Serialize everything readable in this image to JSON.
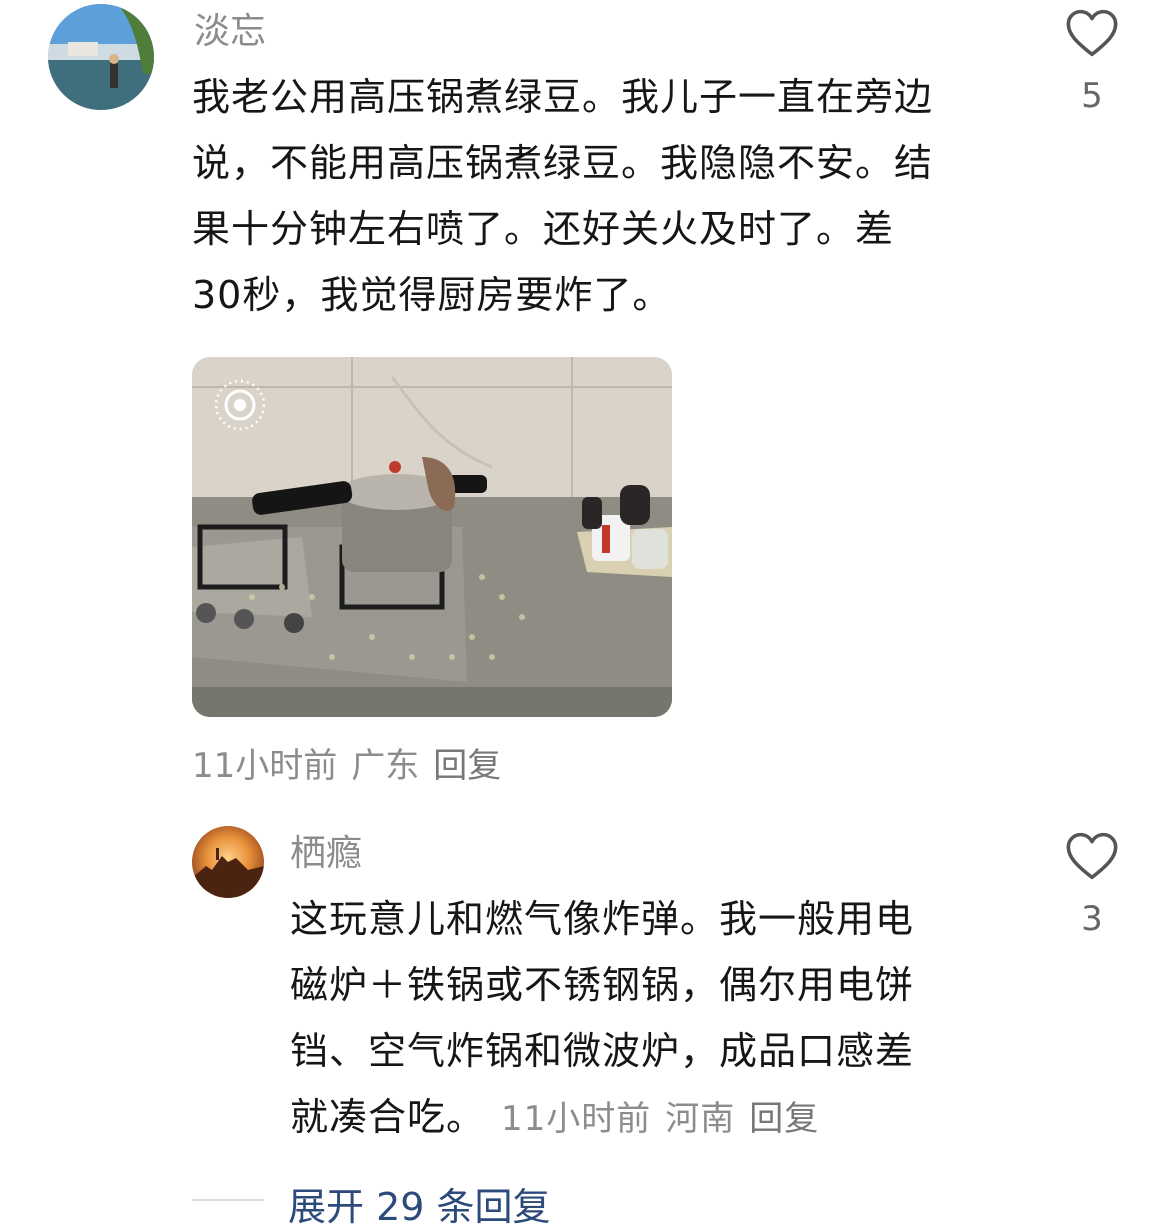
{
  "comment1": {
    "username": "淡忘",
    "lines": [
      "我老公用高压锅煮绿豆。我儿子一直在旁边",
      "说，不能用高压锅煮绿豆。我隐隐不安。结",
      "果十分钟左右喷了。还好关火及时了。差",
      " 30秒，我觉得厨房要炸了。"
    ],
    "like_count": "5",
    "time": "11小时前",
    "location": "广东",
    "reply_label": "回复",
    "image_icon": "live-photo-icon"
  },
  "comment2": {
    "username": "栖瘾",
    "lines": [
      "这玩意儿和燃气像炸弹。我一般用电",
      "磁炉＋铁锅或不锈钢锅，偶尔用电饼",
      "铛、空气炸锅和微波炉，成品口感差",
      "就凑合吃。"
    ],
    "like_count": "3",
    "time": "11小时前",
    "location": "河南",
    "reply_label": "回复"
  },
  "expand_replies": "展开 29 条回复",
  "colors": {
    "meta": "#8c8c8c",
    "link": "#2c4a7a",
    "text": "#161616"
  }
}
